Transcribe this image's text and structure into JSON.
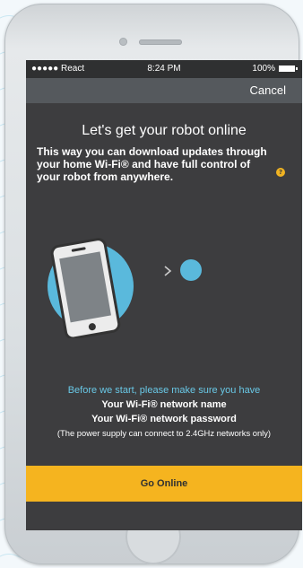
{
  "status_bar": {
    "carrier": "●●●●● React",
    "time": "8:24 PM",
    "battery_text": "100%"
  },
  "nav": {
    "cancel_label": "Cancel"
  },
  "content": {
    "heading": "Let's get your robot online",
    "subtext": "This way you can download updates through your home Wi-Fi® and have full control of your robot from anywhere.",
    "info_badge": "?"
  },
  "prep": {
    "title": "Before we start, please make sure you have",
    "items": [
      "Your Wi-Fi® network name",
      "Your Wi-Fi® network password"
    ],
    "note": "(The power supply can connect to 2.4GHz networks only)"
  },
  "actions": {
    "go_online_label": "Go Online"
  },
  "colors": {
    "accent": "#f5b41f",
    "screen_bg": "#3d3d3f",
    "nav_bg": "#55595d",
    "highlight_text": "#69c8e6",
    "illustration_blue": "#5ab9dc"
  }
}
